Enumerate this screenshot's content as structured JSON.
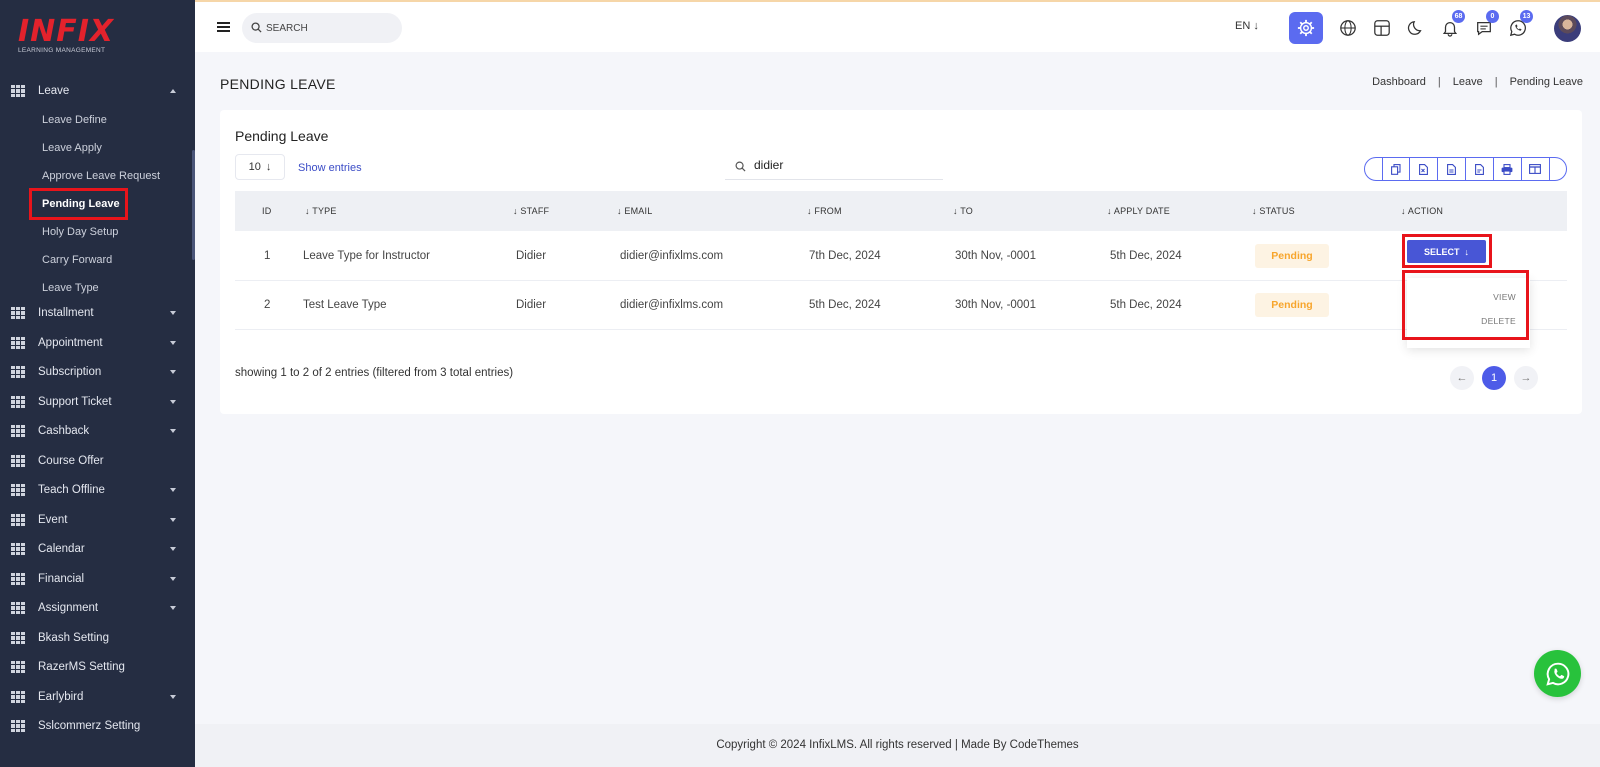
{
  "brand": {
    "name": "INFIX",
    "tagline": "LEARNING MANAGEMENT"
  },
  "sidebar": {
    "leave": {
      "label": "Leave"
    },
    "leave_sub": [
      "Leave Define",
      "Leave Apply",
      "Approve Leave Request",
      "Pending Leave",
      "Holy Day Setup",
      "Carry Forward",
      "Leave Type"
    ],
    "items": [
      {
        "label": "Installment",
        "caret": true
      },
      {
        "label": "Appointment",
        "caret": true
      },
      {
        "label": "Subscription",
        "caret": true
      },
      {
        "label": "Support Ticket",
        "caret": true
      },
      {
        "label": "Cashback",
        "caret": true
      },
      {
        "label": "Course Offer",
        "caret": false
      },
      {
        "label": "Teach Offline",
        "caret": true
      },
      {
        "label": "Event",
        "caret": true
      },
      {
        "label": "Calendar",
        "caret": true
      },
      {
        "label": "Financial",
        "caret": true
      },
      {
        "label": "Assignment",
        "caret": true
      },
      {
        "label": "Bkash Setting",
        "caret": false
      },
      {
        "label": "RazerMS Setting",
        "caret": false
      },
      {
        "label": "Earlybird",
        "caret": true
      },
      {
        "label": "Sslcommerz Setting",
        "caret": false
      }
    ]
  },
  "header": {
    "search_placeholder": "SEARCH",
    "language": "EN",
    "notifications_count": "68",
    "messages_count": "0",
    "whatsapp_count": "13",
    "icons": [
      "settings-icon",
      "globe-icon",
      "layout-icon",
      "moon-icon",
      "bell-icon",
      "chat-icon",
      "whatsapp-icon"
    ]
  },
  "page": {
    "title": "PENDING LEAVE",
    "breadcrumb": [
      "Dashboard",
      "Leave",
      "Pending Leave"
    ]
  },
  "card": {
    "title": "Pending Leave",
    "entries_value": "10",
    "show_entries_label": "Show entries",
    "search_value": "didier",
    "columns": [
      "ID",
      "TYPE",
      "STAFF",
      "EMAIL",
      "FROM",
      "TO",
      "APPLY DATE",
      "STATUS",
      "ACTION"
    ],
    "rows": [
      {
        "id": "1",
        "type": "Leave Type for Instructor",
        "staff": "Didier",
        "email": "didier@infixlms.com",
        "from": "7th Dec, 2024",
        "to": "30th Nov, -0001",
        "apply_date": "5th Dec, 2024",
        "status": "Pending"
      },
      {
        "id": "2",
        "type": "Test Leave Type",
        "staff": "Didier",
        "email": "didier@infixlms.com",
        "from": "5th Dec, 2024",
        "to": "30th Nov, -0001",
        "apply_date": "5th Dec, 2024",
        "status": "Pending"
      }
    ],
    "action_label": "SELECT",
    "action_menu": [
      "VIEW",
      "DELETE"
    ],
    "showing_text": "showing 1 to 2 of 2 entries (filtered from 3 total entries)",
    "current_page": "1"
  },
  "footer": {
    "text": "Copyright © 2024 InfixLMS. All rights reserved | Made By CodeThemes"
  },
  "colors": {
    "sidebar_bg": "#252d42",
    "accent": "#5b6bf0",
    "highlight": "#e8141b",
    "status_pending": "#f7a52c",
    "whatsapp": "#28c23c"
  }
}
